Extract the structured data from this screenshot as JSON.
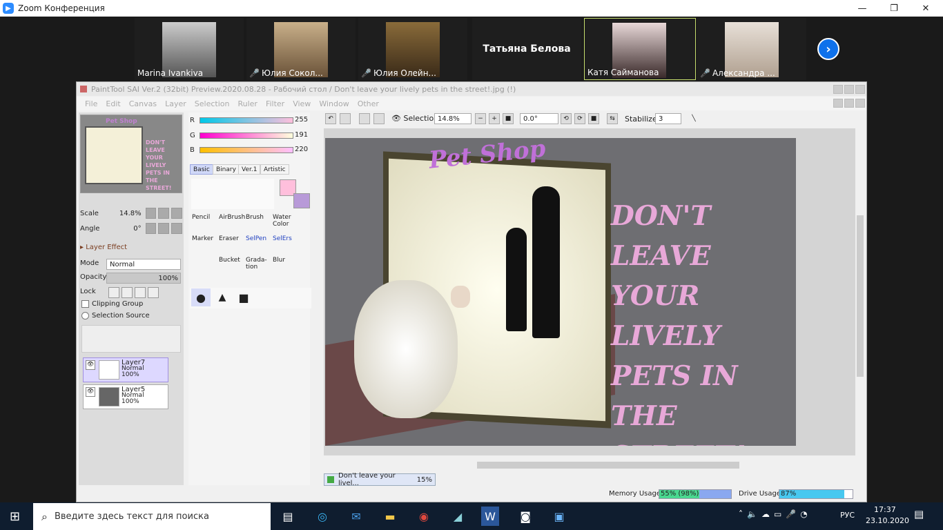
{
  "zoom": {
    "title": "Zoom Конференция",
    "controls": [
      "—",
      "❐",
      "✕"
    ],
    "participants": [
      {
        "name": "Marina Ivankiva",
        "muted": false
      },
      {
        "name": "Юлия Сокол...",
        "muted": true
      },
      {
        "name": "Юлия Олейн...",
        "muted": true
      },
      {
        "name": "Татьяна Белова",
        "muted": false,
        "no_video": true
      },
      {
        "name": "Катя Сайманова",
        "muted": false,
        "active": true
      },
      {
        "name": "Александра ...",
        "muted": true
      }
    ],
    "next_icon": "›"
  },
  "sai": {
    "title": "PaintTool SAI Ver.2 (32bit) Preview.2020.08.28 - Рабочий стол / Don't leave your lively pets in the street!.jpg (!)",
    "menu": [
      "File",
      "Edit",
      "Canvas",
      "Layer",
      "Selection",
      "Ruler",
      "Filter",
      "View",
      "Window",
      "Other"
    ],
    "nav": {
      "scale_label": "Scale",
      "scale_value": "14.8%",
      "angle_label": "Angle",
      "angle_value": "0°"
    },
    "layer_effect": "Layer Effect",
    "mode_label": "Mode",
    "mode_value": "Normal",
    "opacity_label": "Opacity",
    "opacity_value": "100%",
    "lock_label": "Lock",
    "clipping_group": "Clipping Group",
    "selection_source": "Selection Source",
    "layers": [
      {
        "name": "Layer7",
        "mode": "Normal",
        "opacity": "100%"
      },
      {
        "name": "Layer5",
        "mode": "Normal",
        "opacity": "100%"
      }
    ],
    "color": {
      "r_label": "R",
      "r_value": "255",
      "g_label": "G",
      "g_value": "191",
      "b_label": "B",
      "b_value": "220",
      "fg": "#ffbfdc",
      "bg": "#b89ad8"
    },
    "color_tabs": [
      "Basic",
      "Binary",
      "Ver.1",
      "Artistic"
    ],
    "tools": [
      "Pencil",
      "AirBrush",
      "Brush",
      "Water Color",
      "Marker",
      "Eraser",
      "SelPen",
      "SelErs",
      "Bucket",
      "Grada-tion",
      "Blur"
    ],
    "toolbar": {
      "selection_label": "Selection",
      "zoom_value": "14.8%",
      "angle_value": "0.0°",
      "stabilizer_label": "Stabilizer",
      "stabilizer_value": "3"
    },
    "artwork": {
      "shop_sign": "Pet Shop",
      "slogan": [
        "DON'T LEAVE",
        "YOUR LIVELY",
        "PETS IN THE",
        "STREET!"
      ]
    },
    "doc_tab": {
      "name": "Don't leave your livel...",
      "zoom": "15%"
    },
    "status": {
      "memory_label": "Memory Usage",
      "memory_value": "55% (98%)",
      "memory_fill": 0.55,
      "drive_label": "Drive Usage",
      "drive_value": "87%",
      "drive_fill": 0.87
    }
  },
  "taskbar": {
    "search_placeholder": "Введите здесь текст для поиска",
    "lang": "РУС",
    "time": "17:37",
    "date": "23.10.2020"
  }
}
